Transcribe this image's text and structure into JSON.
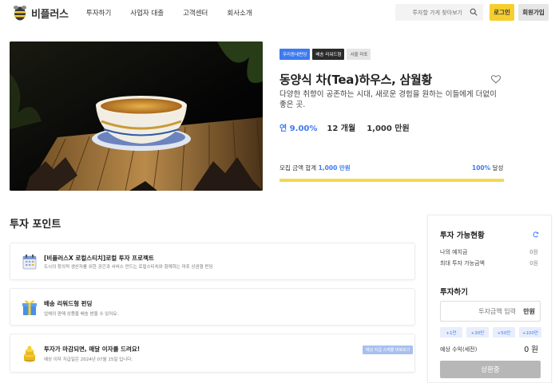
{
  "header": {
    "logo_text": "비플러스",
    "nav": [
      "투자하기",
      "사업자 대출",
      "고객센터",
      "회사소개"
    ],
    "search_placeholder": "투자할 가게 찾아보기",
    "login": "로그인",
    "signup": "회원가입"
  },
  "product": {
    "tags": [
      "우리동네펀딩",
      "배송 리워드형",
      "서울 마포"
    ],
    "title": "동양식 차(Tea)하우스, 삼월황",
    "description": "다양한 취향이 공존하는 시대, 새로운 경험을 원하는 이들에게 더없이 좋은 곳.",
    "rate": "연 9.00%",
    "period": "12 개월",
    "goal": "1,000 만원",
    "raised_label": "모집 금액 합계",
    "raised_amount": "1,000 만원",
    "achieved_pct": "100%",
    "achieved_suffix": "달성",
    "progress": 1.0
  },
  "points": {
    "section_title": "투자 포인트",
    "items": [
      {
        "title": "[비플러스X 로컬스티치]로컬 투자 프로젝트",
        "subtitle": "도시의 창의적 생산자를 위한 공간과 서비스 만드는 로컬스티치와 함께하는 마포 상권형 펀딩",
        "icon": "calendar-icon"
      },
      {
        "title": "배송 리워드형 펀딩",
        "subtitle": "업체의 판매 상품을 배송 받을 수 있어요.",
        "icon": "gift-icon"
      },
      {
        "title": "투자가 마감되면, 매달 이자를 드려요!",
        "subtitle": "예상 이자 지급일은 2024년 07월 15일 입니다.",
        "icon": "coin-stack-icon",
        "badge": "예상 지급 스케쥴 바로보기"
      }
    ]
  },
  "panel": {
    "availability_title": "투자 가능현황",
    "deposit_label": "나의 예치금",
    "deposit_value": "0원",
    "max_label": "최대 투자 가능금액",
    "max_value": "0원",
    "invest_title": "투자하기",
    "amount_placeholder": "투자금액 입력",
    "amount_unit": "만원",
    "quick": [
      "+1만",
      "+30만",
      "+50만",
      "+100만"
    ],
    "est_label": "예상 수익(세전)",
    "est_value": "0 원",
    "status": "상환중"
  }
}
